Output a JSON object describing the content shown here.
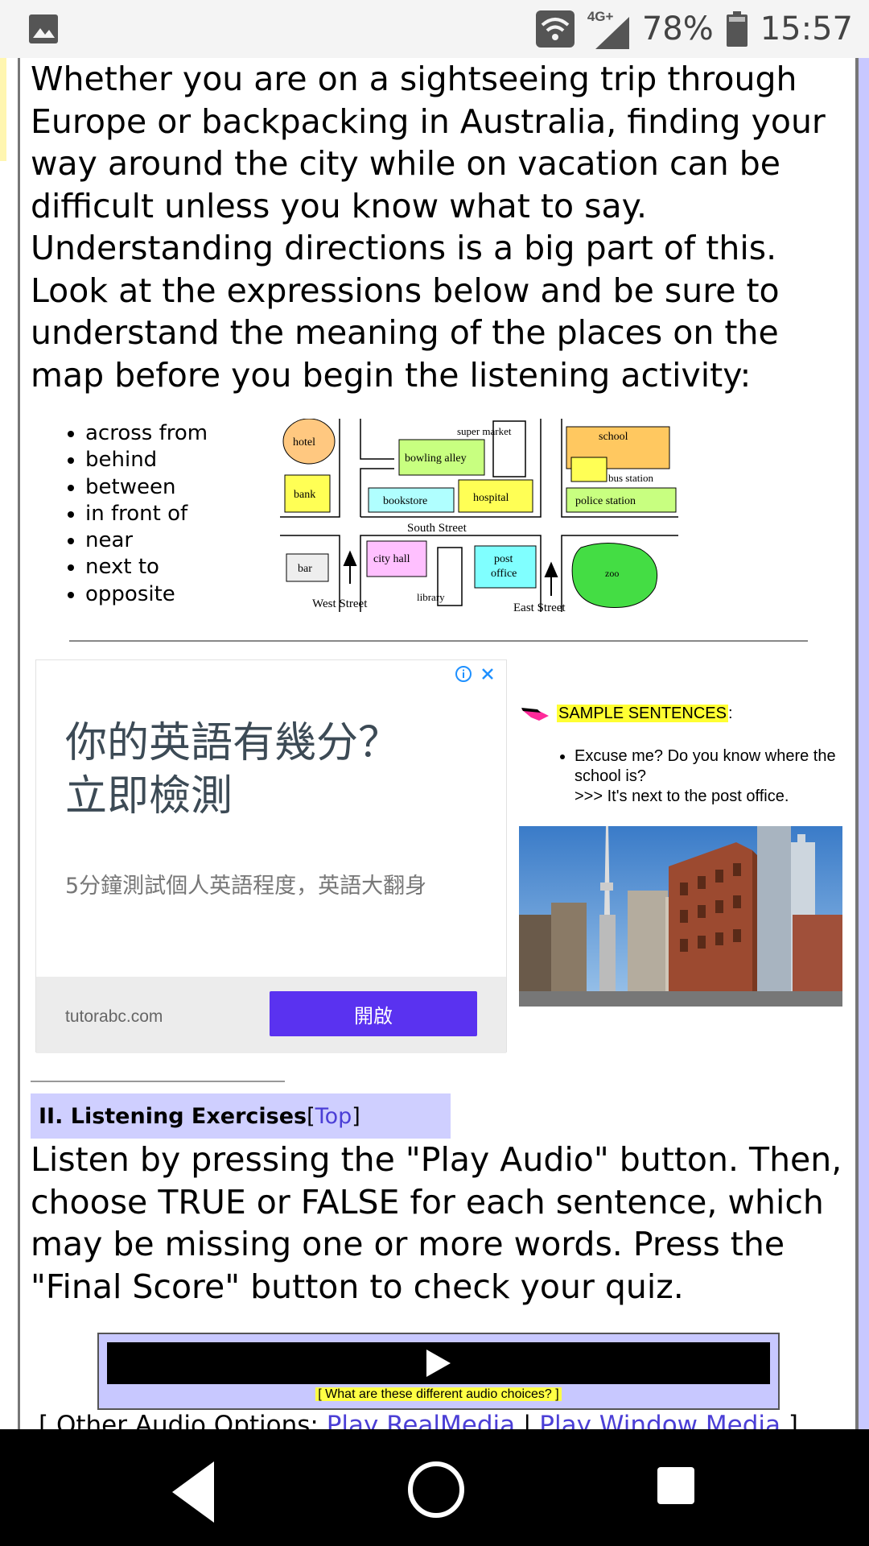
{
  "status_bar": {
    "network": "4G+",
    "battery": "78%",
    "time": "15:57",
    "icons": [
      "gallery-icon",
      "wifi-icon",
      "signal-icon",
      "battery-icon"
    ]
  },
  "intro_text": "Whether you are on a sightseeing trip through Europe or backpacking in Australia, finding your way around the city while on vacation can be difficult unless you know what to say. Understanding directions is a big part of this. Look at the expressions below and be sure to understand the meaning of the places on the map before you begin the listening activity:",
  "expressions": [
    "across from",
    "behind",
    "between",
    "in front of",
    "near",
    "next to",
    "opposite"
  ],
  "map": {
    "hotel": "hotel",
    "bank": "bank",
    "bowling_alley": "bowling alley",
    "supermarket": "super market",
    "bookstore": "bookstore",
    "hospital": "hospital",
    "school": "school",
    "bus_station": "bus station",
    "police_station": "police station",
    "south_street": "South Street",
    "bar": "bar",
    "city_hall": "city hall",
    "library": "library",
    "post_office_1": "post",
    "post_office_2": "office",
    "zoo": "zoo",
    "west_street": "West Street",
    "east_street": "East Street"
  },
  "ad": {
    "title_line1": "你的英語有幾分？",
    "title_line2": "立即檢測",
    "subtitle": "5分鐘測試個人英語程度，英語大翻身",
    "domain": "tutorabc.com",
    "cta": "開啟"
  },
  "sample": {
    "label": "SAMPLE SENTENCES",
    "colon": ":",
    "question": "Excuse me? Do you know where the school is?",
    "answer": ">>> It's next to the post office."
  },
  "section": {
    "title": "II. Listening Exercises",
    "open_bracket": " [",
    "top_link": "Top",
    "close_bracket": "]"
  },
  "instructions": "Listen by pressing the \"Play Audio\" button. Then, choose TRUE or FALSE for each sentence, which may be missing one or more words. Press the \"Final Score\" button to check your quiz.",
  "audio": {
    "help": "[ What are these different audio choices? ]",
    "other_prefix": "[ Other Audio Options: ",
    "realmedia": "Play RealMedia",
    "separator": " | ",
    "windows_media": "Play Window Media",
    "suffix": " ]"
  },
  "nav": {
    "back": "back",
    "home": "home",
    "recents": "recents"
  }
}
